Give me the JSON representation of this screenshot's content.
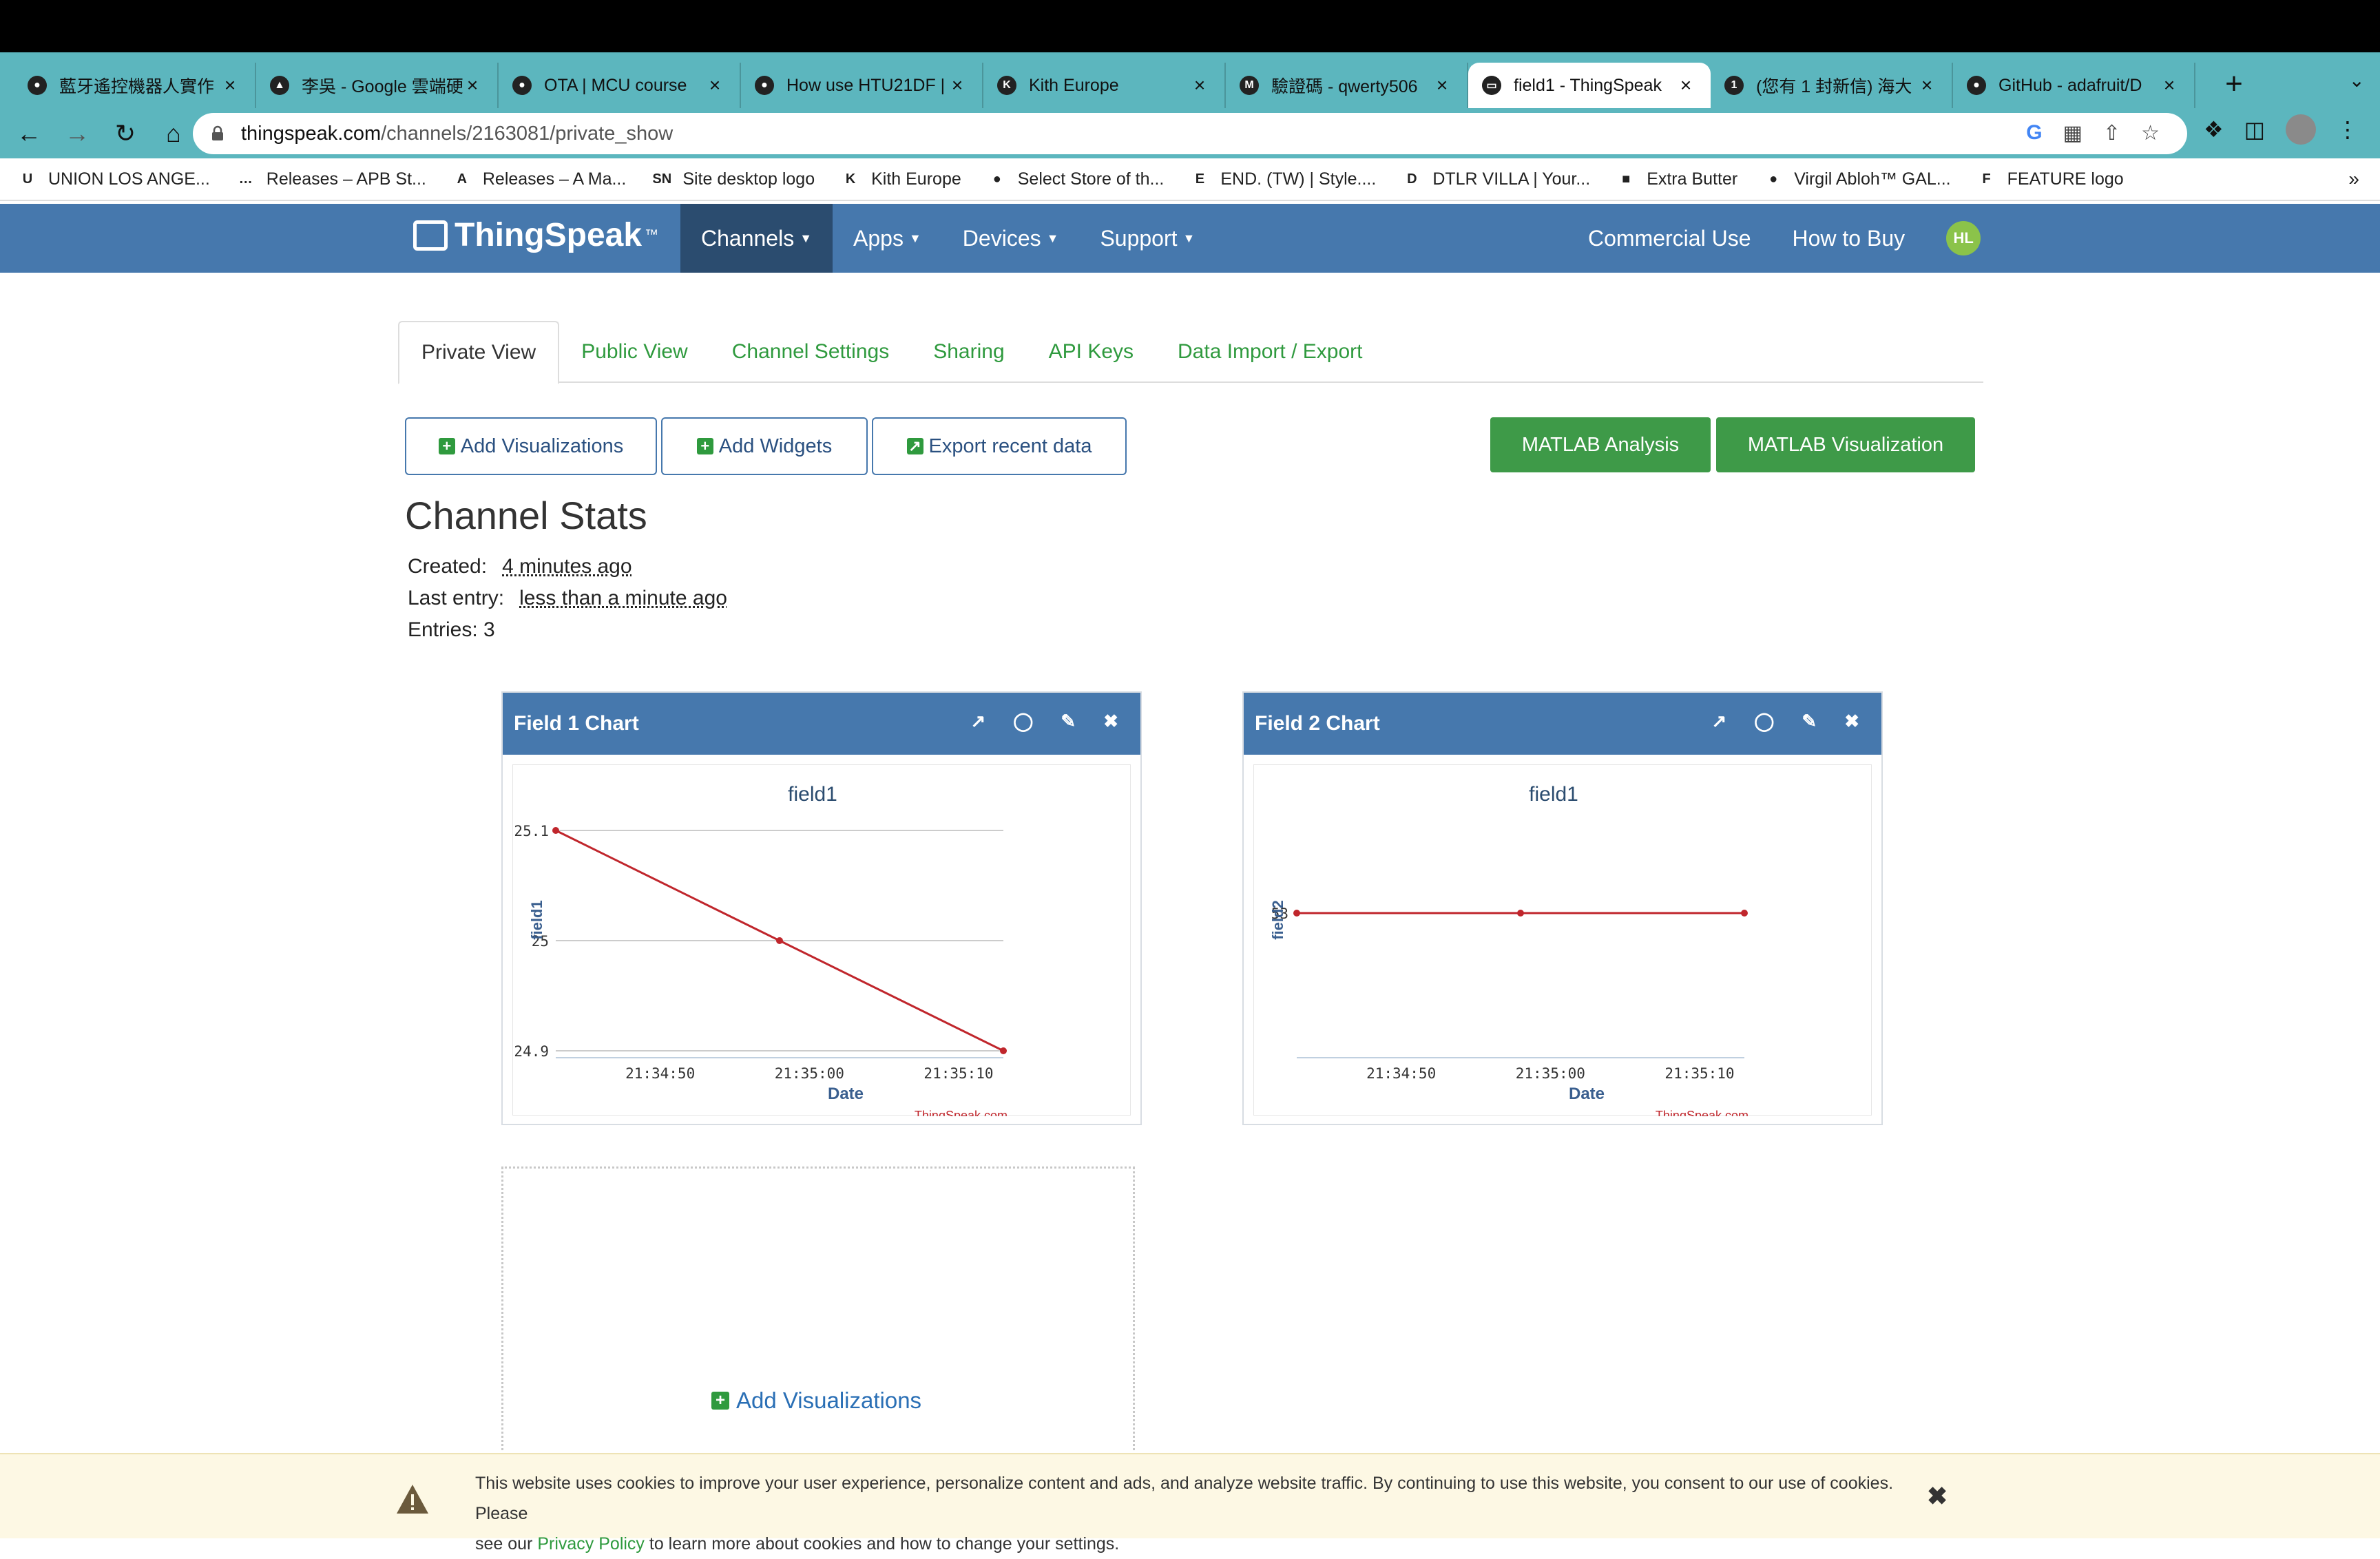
{
  "browser": {
    "tabs": [
      {
        "title": "藍牙遙控機器人實作 |",
        "icon": "globe-icon",
        "active": false
      },
      {
        "title": "李吳 - Google 雲端硬",
        "icon": "google-drive-icon",
        "active": false
      },
      {
        "title": "OTA | MCU course",
        "icon": "globe-icon",
        "active": false
      },
      {
        "title": "How use HTU21DF |",
        "icon": "globe-icon",
        "active": false
      },
      {
        "title": "Kith Europe",
        "icon": "kith-icon",
        "active": false
      },
      {
        "title": "驗證碼 - qwerty506",
        "icon": "gmail-icon",
        "active": false
      },
      {
        "title": "field1 - ThingSpeak",
        "icon": "thingspeak-icon",
        "active": true
      },
      {
        "title": "(您有 1 封新信) 海大",
        "icon": "mail-icon",
        "active": false
      },
      {
        "title": "GitHub - adafruit/D",
        "icon": "github-icon",
        "active": false
      }
    ],
    "url_host": "thingspeak.com",
    "url_path": "/channels/2163081/private_show",
    "bookmarks": [
      {
        "label": "UNION LOS ANGE...",
        "icon": "U"
      },
      {
        "label": "Releases – APB St...",
        "icon": "…"
      },
      {
        "label": "Releases – A Ma...",
        "icon": "A"
      },
      {
        "label": "Site desktop logo",
        "icon": "SN"
      },
      {
        "label": "Kith Europe",
        "icon": "K"
      },
      {
        "label": "Select Store of th...",
        "icon": "●"
      },
      {
        "label": "END. (TW) | Style....",
        "icon": "E"
      },
      {
        "label": "DTLR VILLA | Your...",
        "icon": "D"
      },
      {
        "label": "Extra Butter",
        "icon": "■"
      },
      {
        "label": "Virgil Abloh™ GAL...",
        "icon": "●"
      },
      {
        "label": "FEATURE logo",
        "icon": "F"
      }
    ]
  },
  "nav": {
    "logo": "ThingSpeak",
    "logo_tm": "™",
    "items": [
      "Channels",
      "Apps",
      "Devices",
      "Support"
    ],
    "right_items": [
      "Commercial Use",
      "How to Buy"
    ],
    "avatar": "HL"
  },
  "channel_tabs": [
    "Private View",
    "Public View",
    "Channel Settings",
    "Sharing",
    "API Keys",
    "Data Import / Export"
  ],
  "buttons": {
    "add_visualizations": "Add Visualizations",
    "add_widgets": "Add Widgets",
    "export_recent": "Export recent data",
    "matlab_analysis": "MATLAB Analysis",
    "matlab_visualization": "MATLAB Visualization"
  },
  "stats": {
    "title": "Channel Stats",
    "created_label": "Created:",
    "created_value": "4 minutes ago",
    "last_entry_label": "Last entry:",
    "last_entry_value": "less than a minute ago",
    "entries": "Entries: 3"
  },
  "cards": [
    {
      "header": "Field 1 Chart"
    },
    {
      "header": "Field 2 Chart"
    }
  ],
  "chart_data": [
    {
      "type": "line",
      "title": "field1",
      "xlabel": "Date",
      "ylabel": "field1",
      "x": [
        "21:34:43",
        "21:34:58",
        "21:35:13"
      ],
      "x_ticks": [
        "21:34:50",
        "21:35:00",
        "21:35:10"
      ],
      "y_ticks": [
        "25.1",
        "25",
        "24.9"
      ],
      "series": [
        {
          "values": [
            25.1,
            25.0,
            24.9
          ]
        }
      ],
      "ylim": [
        24.9,
        25.1
      ],
      "credit": "ThingSpeak.com",
      "color": "#c0262c"
    },
    {
      "type": "line",
      "title": "field1",
      "xlabel": "Date",
      "ylabel": "field2",
      "x": [
        "21:34:43",
        "21:34:58",
        "21:35:13"
      ],
      "x_ticks": [
        "21:34:50",
        "21:35:00",
        "21:35:10"
      ],
      "y_ticks": [
        "53"
      ],
      "series": [
        {
          "values": [
            53,
            53,
            53
          ]
        }
      ],
      "ylim": [
        53,
        53
      ],
      "credit": "ThingSpeak.com",
      "color": "#c0262c"
    }
  ],
  "add_visualizations_link": "Add Visualizations",
  "cookie": {
    "text_1": "This website uses cookies to improve your user experience, personalize content and ads, and analyze website traffic. By continuing to use this website, you consent to our use of cookies. Please",
    "text_2a": "see our",
    "link": "Privacy Policy",
    "text_2b": "to learn more about cookies and how to change your settings."
  }
}
